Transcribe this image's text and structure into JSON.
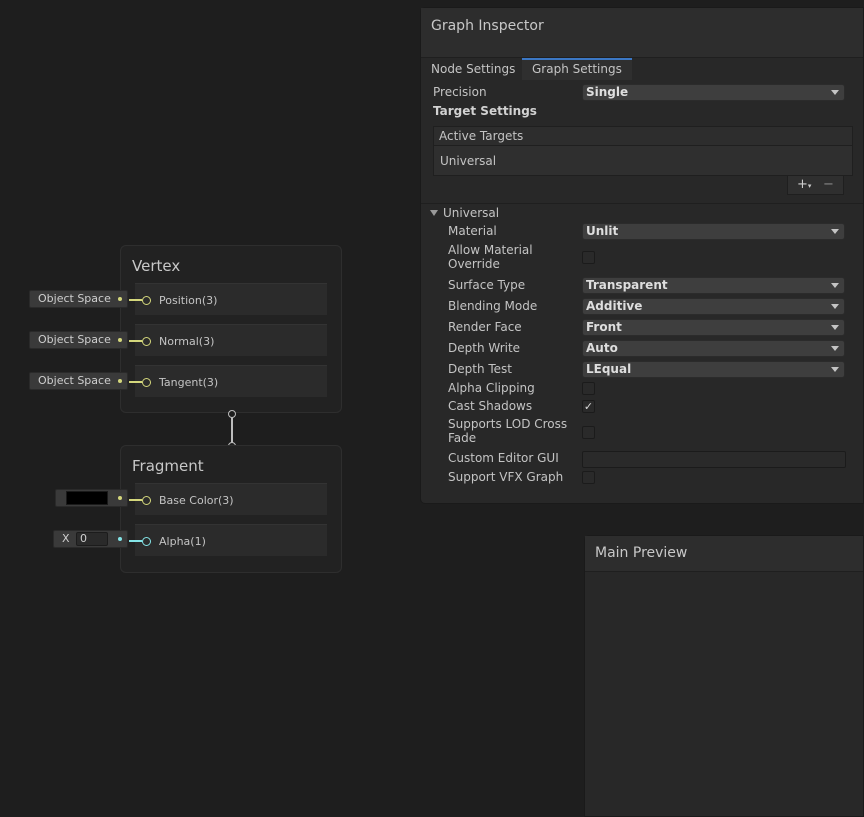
{
  "vertex": {
    "title": "Vertex",
    "slots": [
      {
        "label": "Position(3)",
        "input": "Object Space"
      },
      {
        "label": "Normal(3)",
        "input": "Object Space"
      },
      {
        "label": "Tangent(3)",
        "input": "Object Space"
      }
    ]
  },
  "fragment": {
    "title": "Fragment",
    "slots": [
      {
        "label": "Base Color(3)",
        "input_color": "#000000"
      },
      {
        "label": "Alpha(1)",
        "input_axis": "X",
        "input_value": "0"
      }
    ]
  },
  "inspector": {
    "title": "Graph Inspector",
    "tabs": [
      "Node Settings",
      "Graph Settings"
    ],
    "active_tab": "Graph Settings",
    "precision_label": "Precision",
    "precision_value": "Single",
    "target_settings_label": "Target Settings",
    "active_targets_label": "Active Targets",
    "active_targets": [
      "Universal"
    ],
    "add_button": "+",
    "add_button_caret": "▾",
    "remove_button": "−",
    "section_title": "Universal",
    "properties": {
      "material": {
        "label": "Material",
        "value": "Unlit"
      },
      "allow_override": {
        "label": "Allow Material Override",
        "checked": false
      },
      "surface_type": {
        "label": "Surface Type",
        "value": "Transparent"
      },
      "blending_mode": {
        "label": "Blending Mode",
        "value": "Additive"
      },
      "render_face": {
        "label": "Render Face",
        "value": "Front"
      },
      "depth_write": {
        "label": "Depth Write",
        "value": "Auto"
      },
      "depth_test": {
        "label": "Depth Test",
        "value": "LEqual"
      },
      "alpha_clipping": {
        "label": "Alpha Clipping",
        "checked": false
      },
      "cast_shadows": {
        "label": "Cast Shadows",
        "checked": true,
        "mark": "✓"
      },
      "lod_crossfade": {
        "label": "Supports LOD Cross Fade",
        "checked": false
      },
      "custom_editor": {
        "label": "Custom Editor GUI",
        "value": ""
      },
      "vfx_graph": {
        "label": "Support VFX Graph",
        "checked": false
      }
    }
  },
  "preview": {
    "title": "Main Preview"
  },
  "colors": {
    "background": "#1e1e1e",
    "vector3_port": "#d4d77c",
    "float_port": "#84e4e7",
    "tab_accent": "#3b77c4"
  }
}
